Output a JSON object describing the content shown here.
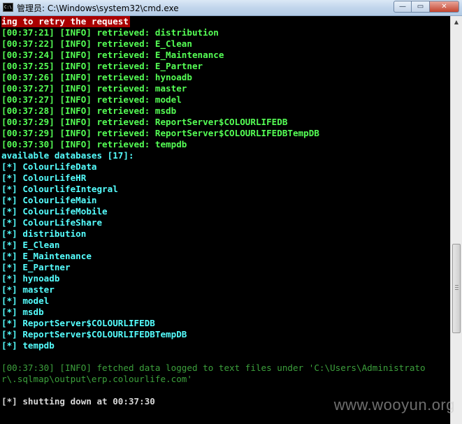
{
  "window": {
    "title": "管理员: C:\\Windows\\system32\\cmd.exe",
    "icon": "cmd-icon",
    "controls": {
      "minimize": "—",
      "maximize": "▭",
      "close": "✕"
    }
  },
  "console": {
    "lines": [
      {
        "style": "warn",
        "text": "ing to retry the request"
      },
      {
        "style": "bright",
        "text": "[00:37:21] [INFO] retrieved: distribution"
      },
      {
        "style": "bright",
        "text": "[00:37:22] [INFO] retrieved: E_Clean"
      },
      {
        "style": "bright",
        "text": "[00:37:24] [INFO] retrieved: E_Maintenance"
      },
      {
        "style": "bright",
        "text": "[00:37:25] [INFO] retrieved: E_Partner"
      },
      {
        "style": "bright",
        "text": "[00:37:26] [INFO] retrieved: hynoadb"
      },
      {
        "style": "bright",
        "text": "[00:37:27] [INFO] retrieved: master"
      },
      {
        "style": "bright",
        "text": "[00:37:27] [INFO] retrieved: model"
      },
      {
        "style": "bright",
        "text": "[00:37:28] [INFO] retrieved: msdb"
      },
      {
        "style": "bright",
        "text": "[00:37:29] [INFO] retrieved: ReportServer$COLOURLIFEDB"
      },
      {
        "style": "bright",
        "text": "[00:37:29] [INFO] retrieved: ReportServer$COLOURLIFEDBTempDB"
      },
      {
        "style": "bright",
        "text": "[00:37:30] [INFO] retrieved: tempdb"
      },
      {
        "style": "cyan",
        "text": "available databases [17]:"
      },
      {
        "style": "cyan",
        "text": "[*] ColourLifeData"
      },
      {
        "style": "cyan",
        "text": "[*] ColourLifeHR"
      },
      {
        "style": "cyan",
        "text": "[*] ColourlifeIntegral"
      },
      {
        "style": "cyan",
        "text": "[*] ColourLifeMain"
      },
      {
        "style": "cyan",
        "text": "[*] ColourLifeMobile"
      },
      {
        "style": "cyan",
        "text": "[*] ColourLifeShare"
      },
      {
        "style": "cyan",
        "text": "[*] distribution"
      },
      {
        "style": "cyan",
        "text": "[*] E_Clean"
      },
      {
        "style": "cyan",
        "text": "[*] E_Maintenance"
      },
      {
        "style": "cyan",
        "text": "[*] E_Partner"
      },
      {
        "style": "cyan",
        "text": "[*] hynoadb"
      },
      {
        "style": "cyan",
        "text": "[*] master"
      },
      {
        "style": "cyan",
        "text": "[*] model"
      },
      {
        "style": "cyan",
        "text": "[*] msdb"
      },
      {
        "style": "cyan",
        "text": "[*] ReportServer$COLOURLIFEDB"
      },
      {
        "style": "cyan",
        "text": "[*] ReportServer$COLOURLIFEDBTempDB"
      },
      {
        "style": "cyan",
        "text": "[*] tempdb"
      },
      {
        "style": "blank",
        "text": ""
      },
      {
        "style": "dim",
        "text": "[00:37:30] [INFO] fetched data logged to text files under 'C:\\Users\\Administrato"
      },
      {
        "style": "dim",
        "text": "r\\.sqlmap\\output\\erp.colourlife.com'"
      },
      {
        "style": "blank",
        "text": ""
      },
      {
        "style": "white",
        "text": "[*] shutting down at 00:37:30"
      }
    ]
  },
  "watermark": "www.wooyun.org",
  "colors": {
    "console_bg": "#000000",
    "info_green": "#55ff55",
    "info_dim_green": "#3ca03c",
    "database_cyan": "#55ffff",
    "warning_bg": "#aa0000",
    "text_white": "#d8d8d8",
    "titlebar": "#c2d6ec"
  }
}
